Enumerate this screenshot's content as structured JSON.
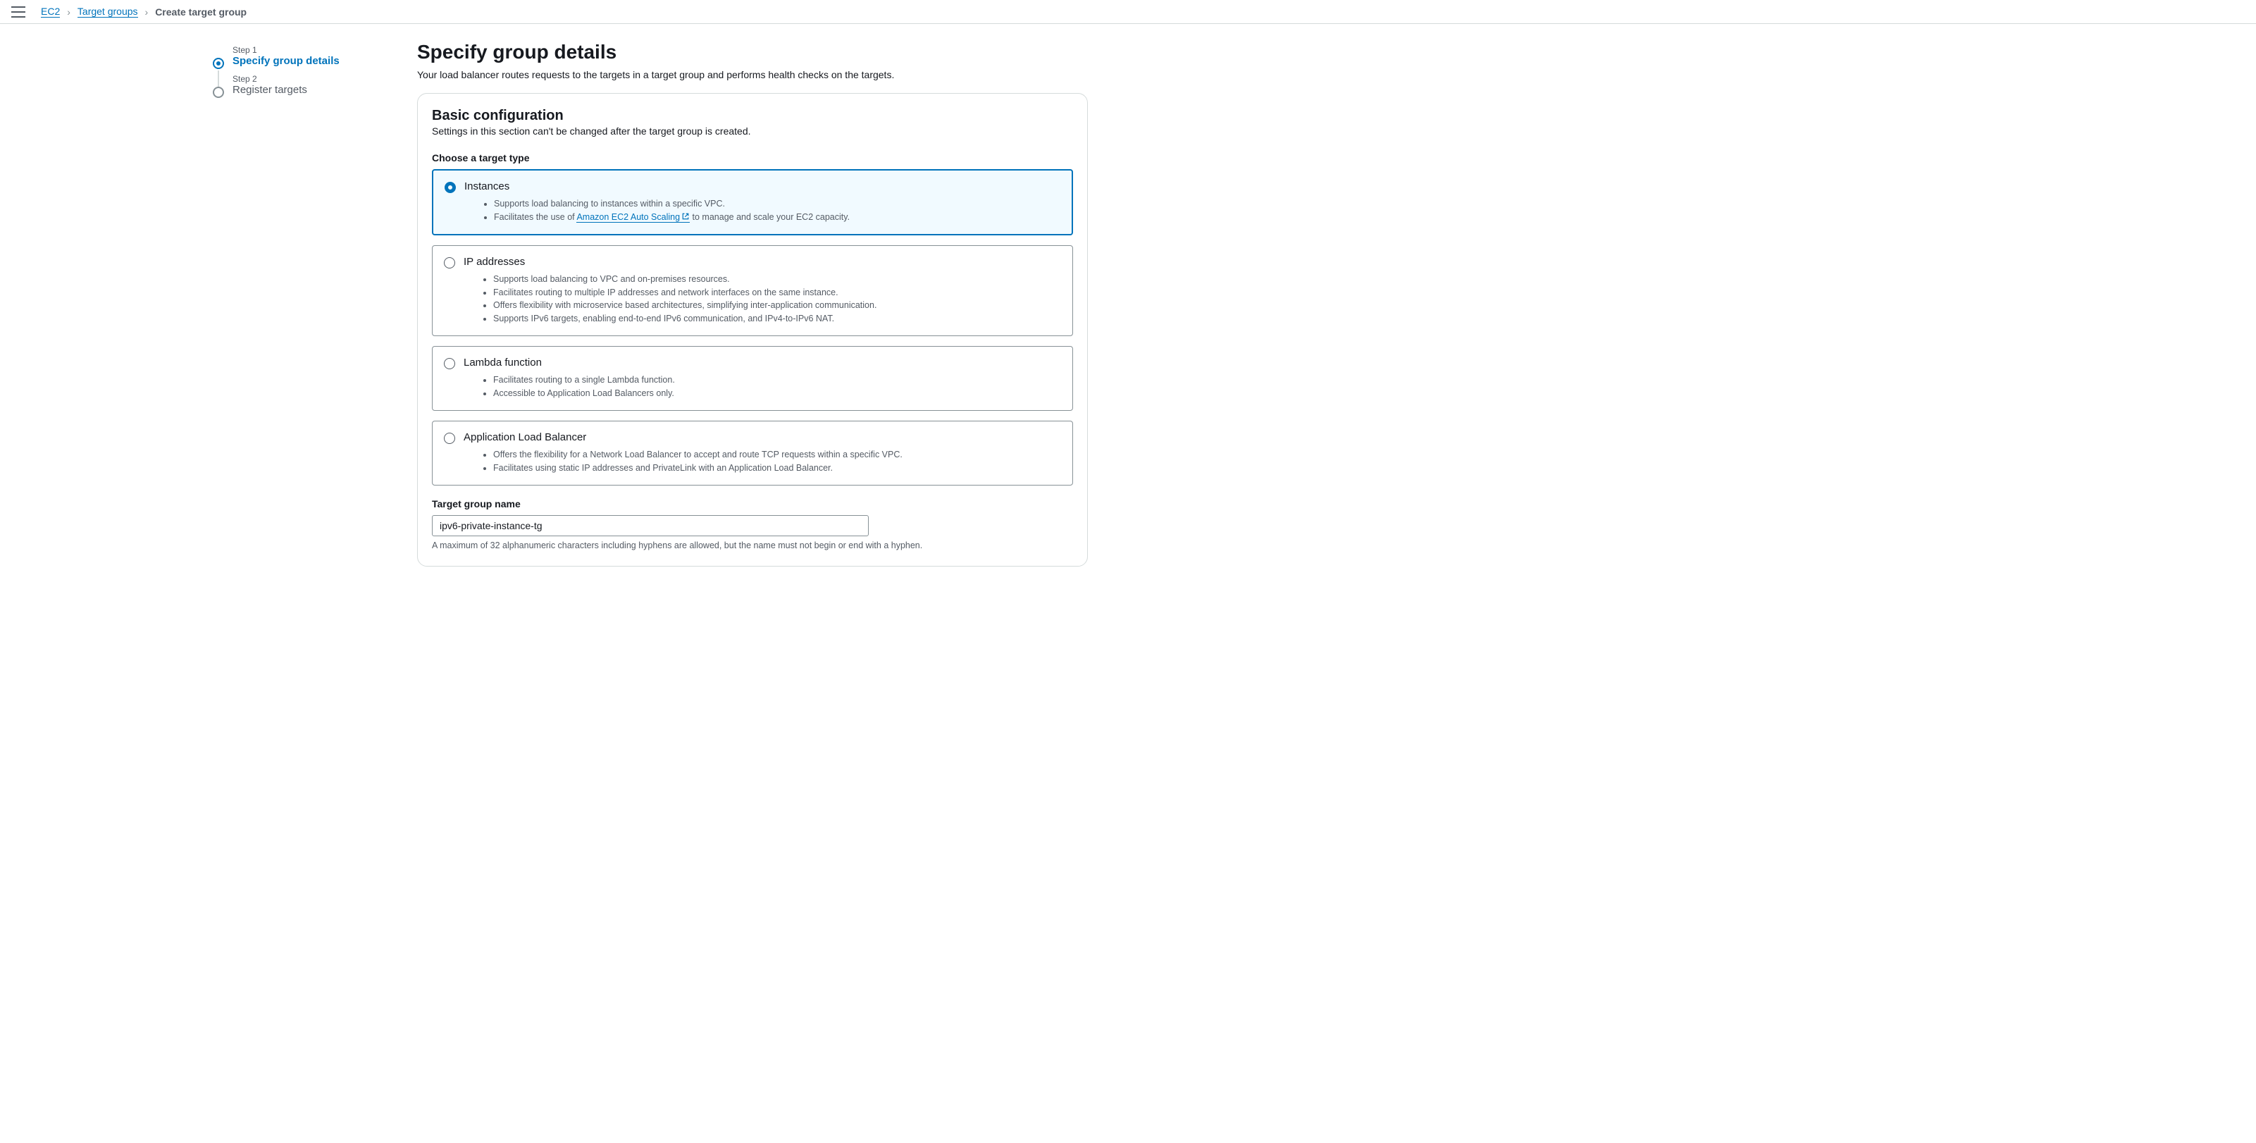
{
  "breadcrumbs": {
    "ec2": "EC2",
    "tg": "Target groups",
    "current": "Create target group"
  },
  "steps": [
    {
      "label": "Step 1",
      "title": "Specify group details"
    },
    {
      "label": "Step 2",
      "title": "Register targets"
    }
  ],
  "page": {
    "heading": "Specify group details",
    "subheading": "Your load balancer routes requests to the targets in a target group and performs health checks on the targets."
  },
  "basic": {
    "title": "Basic configuration",
    "desc": "Settings in this section can't be changed after the target group is created.",
    "choose_label": "Choose a target type",
    "instances": {
      "title": "Instances",
      "b1": "Supports load balancing to instances within a specific VPC.",
      "b2a": "Facilitates the use of ",
      "b2link": "Amazon EC2 Auto Scaling",
      "b2b": " to manage and scale your EC2 capacity."
    },
    "ip": {
      "title": "IP addresses",
      "b1": "Supports load balancing to VPC and on-premises resources.",
      "b2": "Facilitates routing to multiple IP addresses and network interfaces on the same instance.",
      "b3": "Offers flexibility with microservice based architectures, simplifying inter-application communication.",
      "b4": "Supports IPv6 targets, enabling end-to-end IPv6 communication, and IPv4-to-IPv6 NAT."
    },
    "lambda": {
      "title": "Lambda function",
      "b1": "Facilitates routing to a single Lambda function.",
      "b2": "Accessible to Application Load Balancers only."
    },
    "alb": {
      "title": "Application Load Balancer",
      "b1": "Offers the flexibility for a Network Load Balancer to accept and route TCP requests within a specific VPC.",
      "b2": "Facilitates using static IP addresses and PrivateLink with an Application Load Balancer."
    },
    "tg_name_label": "Target group name",
    "tg_name_value": "ipv6-private-instance-tg",
    "tg_name_hint": "A maximum of 32 alphanumeric characters including hyphens are allowed, but the name must not begin or end with a hyphen."
  }
}
